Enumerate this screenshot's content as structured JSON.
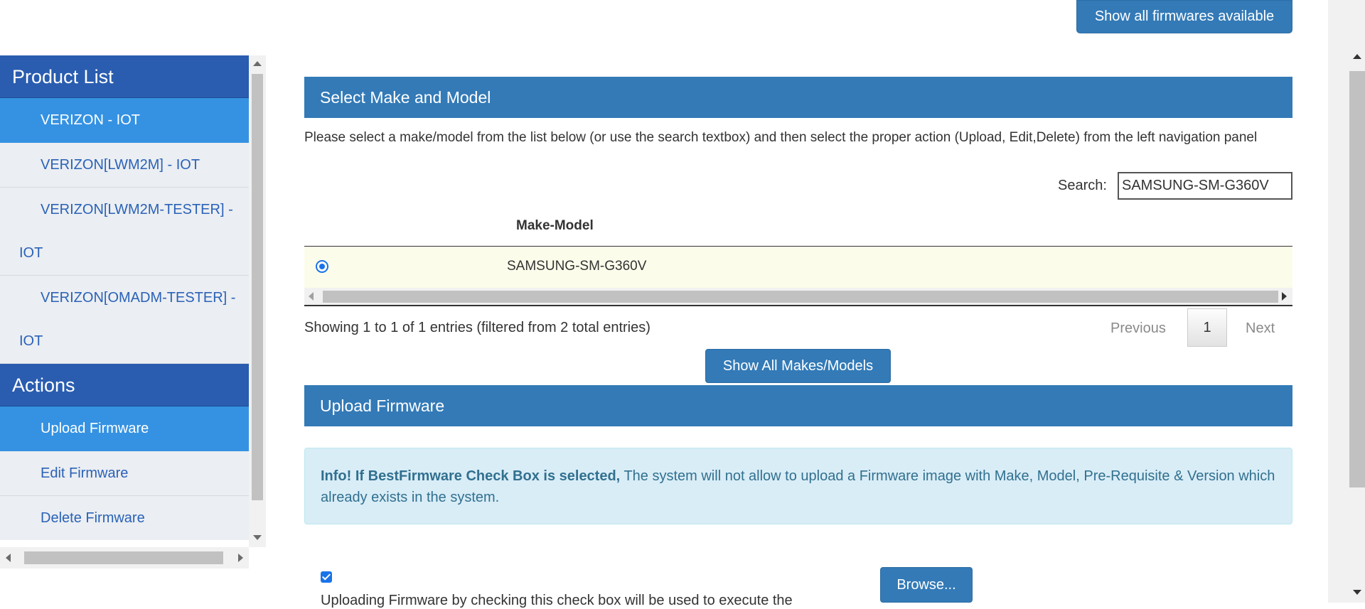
{
  "top_button": {
    "label": "Show all firmwares available"
  },
  "sidebar": {
    "product_header": "Product List",
    "products": [
      {
        "line1": "VERIZON - IOT",
        "line2": ""
      },
      {
        "line1": "VERIZON[LWM2M] - IOT",
        "line2": ""
      },
      {
        "line1": "VERIZON[LWM2M-TESTER] -",
        "line2": "IOT"
      },
      {
        "line1": "VERIZON[OMADM-TESTER] -",
        "line2": "IOT"
      }
    ],
    "actions_header": "Actions",
    "actions": [
      "Upload Firmware",
      "Edit Firmware",
      "Delete Firmware"
    ]
  },
  "select_panel": {
    "title": "Select Make and Model",
    "instructions": "Please select a make/model from the list below (or use the search textbox) and then select the proper action (Upload, Edit,Delete) from the left navigation panel",
    "search_label": "Search:",
    "search_value": "SAMSUNG-SM-G360V",
    "column_header": "Make-Model",
    "rows": [
      "SAMSUNG-SM-G360V"
    ],
    "info": "Showing 1 to 1 of 1 entries (filtered from 2 total entries)",
    "pager": {
      "previous": "Previous",
      "page": "1",
      "next": "Next"
    },
    "show_all_button": "Show All Makes/Models"
  },
  "upload_panel": {
    "title": "Upload Firmware",
    "alert_bold": "Info! If BestFirmware Check Box is selected,",
    "alert_text": " The system will not allow to upload a Firmware image with Make, Model, Pre-Requisite & Version which already exists in the system.",
    "checkbox_note": "Uploading Firmware by checking this check box will be used to execute the",
    "browse_button": "Browse..."
  },
  "colors": {
    "primary": "#337ab7",
    "sidebar_header": "#2a5db0",
    "sidebar_active": "#3592e2",
    "alert_bg": "#d9edf7",
    "row_highlight": "#fcfcea"
  }
}
